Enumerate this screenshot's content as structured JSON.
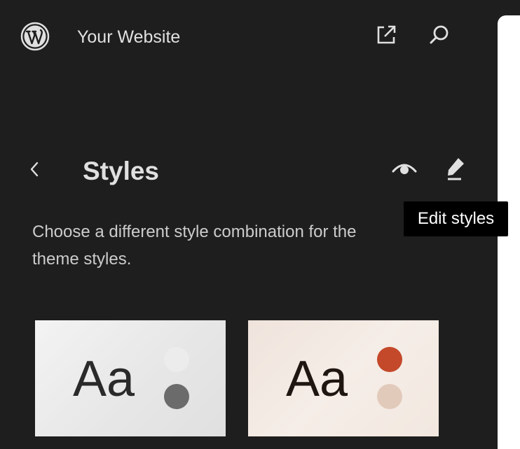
{
  "header": {
    "site_title": "Your Website",
    "logo_icon": "wordpress-logo-icon",
    "external_icon": "external-link-icon",
    "search_icon": "search-icon"
  },
  "panel": {
    "title": "Styles",
    "back_icon": "chevron-left-icon",
    "preview_icon": "eye-icon",
    "edit_icon": "pencil-icon",
    "tooltip": "Edit styles",
    "description_line1": "Choose a different style combination for the",
    "description_line2": "theme styles."
  },
  "style_cards": [
    {
      "sample": "Aa",
      "text_color": "#2a2a2a",
      "dot_colors": [
        "#ececec",
        "#6b6b6b"
      ]
    },
    {
      "sample": "Aa",
      "text_color": "#1f1511",
      "dot_colors": [
        "#c4492a",
        "#e2cabb"
      ]
    }
  ],
  "colors": {
    "sidebar_bg": "#1e1e1e",
    "text": "#e0e0e0",
    "tooltip_bg": "#000000"
  }
}
